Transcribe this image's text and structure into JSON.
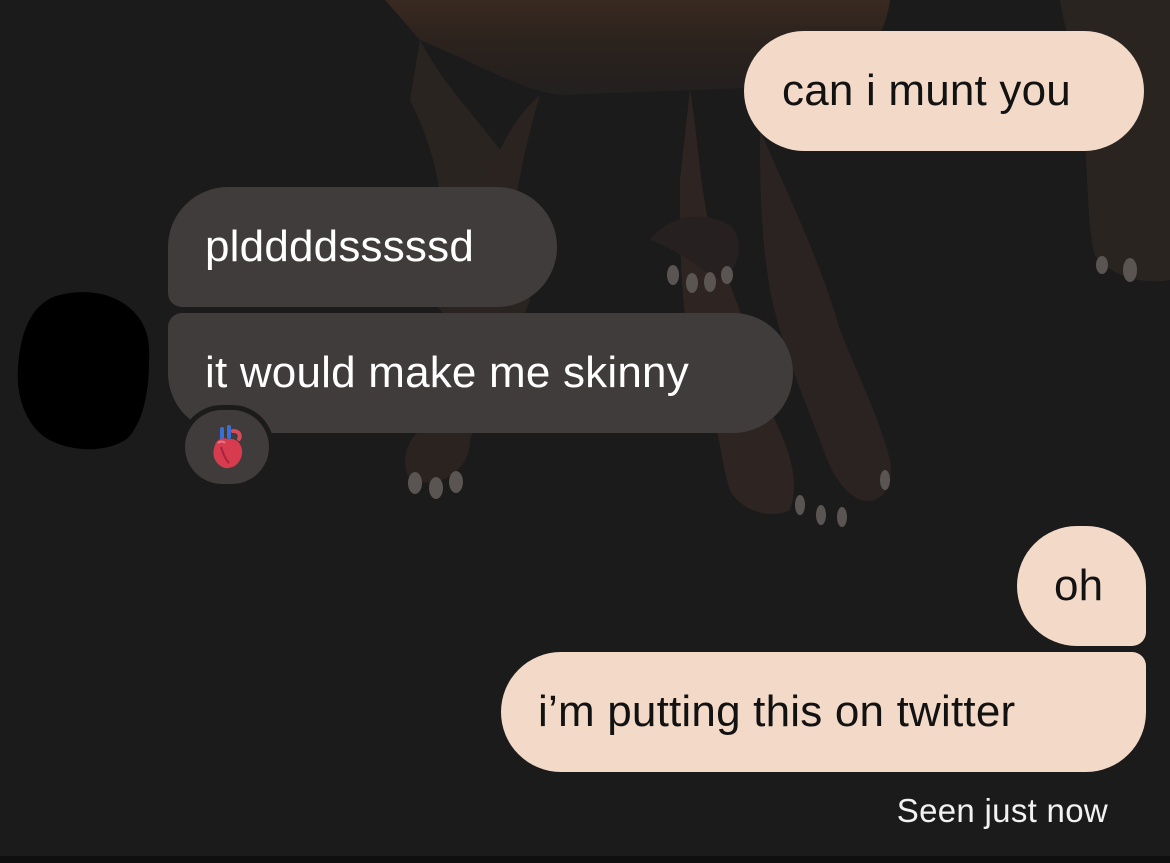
{
  "conversation": {
    "messages": [
      {
        "direction": "outgoing",
        "text": "can i munt you"
      },
      {
        "direction": "incoming",
        "text": "pldddds​ssssd"
      },
      {
        "direction": "incoming",
        "text": "it would make me skinny"
      },
      {
        "direction": "outgoing",
        "text": "oh"
      },
      {
        "direction": "outgoing",
        "text": "i’m putting this on twitter"
      }
    ],
    "reaction": {
      "emoji": "anatomical-heart-icon"
    },
    "status": "Seen just now"
  },
  "colors": {
    "background": "#1c1b1c",
    "outgoing_bubble": "#f3d9c7",
    "incoming_bubble": "#403c3b",
    "outgoing_text": "#121212",
    "incoming_text": "#ffffff"
  }
}
